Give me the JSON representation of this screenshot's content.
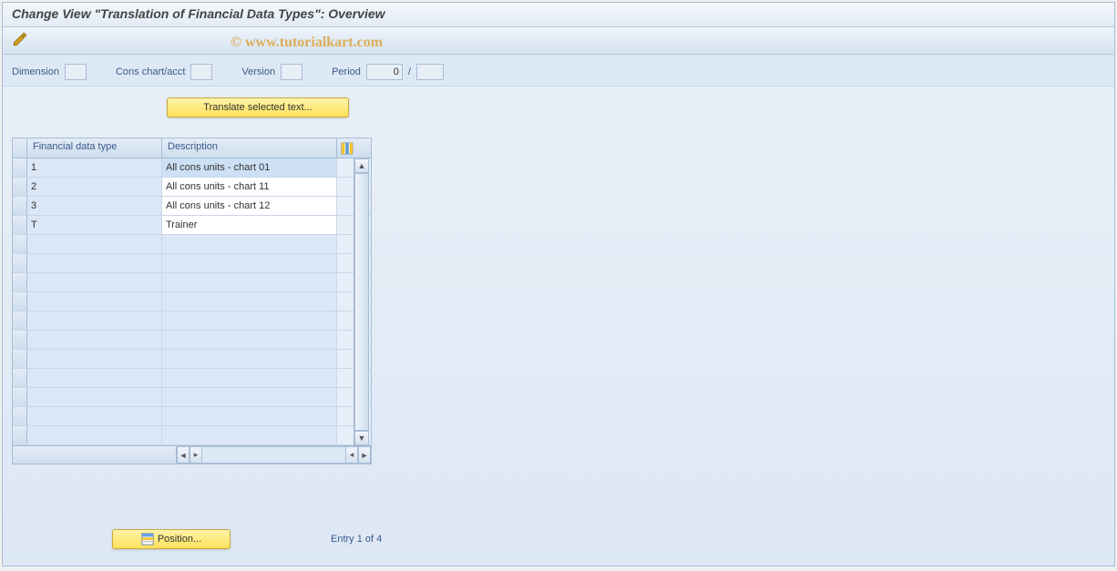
{
  "watermark": "© www.tutorialkart.com",
  "title": "Change View \"Translation of Financial Data Types\": Overview",
  "fields": {
    "dimension_label": "Dimension",
    "dimension_value": "",
    "cons_label": "Cons chart/acct",
    "cons_value": "",
    "version_label": "Version",
    "version_value": "",
    "period_label": "Period",
    "period_value1": "0",
    "period_sep": "/",
    "period_value2": ""
  },
  "buttons": {
    "translate": "Translate selected text...",
    "position": "Position..."
  },
  "table": {
    "col1": "Financial data type",
    "col2": "Description",
    "rows": [
      {
        "type": "1",
        "desc": "All cons units - chart 01",
        "selected": true
      },
      {
        "type": "2",
        "desc": "All cons units - chart 11",
        "selected": false
      },
      {
        "type": "3",
        "desc": "All cons units - chart 12",
        "selected": false
      },
      {
        "type": "T",
        "desc": "Trainer",
        "selected": false
      }
    ],
    "empty_rows": 11
  },
  "footer": {
    "entry": "Entry 1 of 4"
  }
}
